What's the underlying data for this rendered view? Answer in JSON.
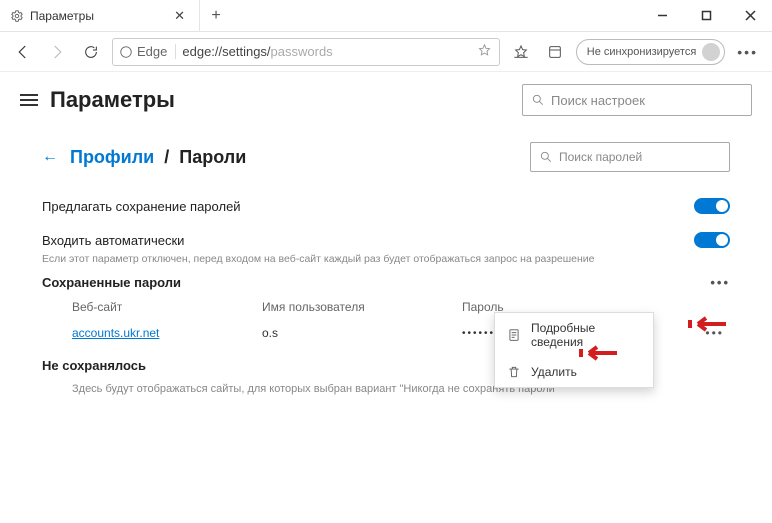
{
  "tab": {
    "title": "Параметры"
  },
  "addressbar": {
    "provider": "Edge",
    "url_prefix": "edge://settings/",
    "url_path": "passwords"
  },
  "sync_pill": "Не синхронизируется",
  "settings_title": "Параметры",
  "settings_search_placeholder": "Поиск настроек",
  "breadcrumb": {
    "parent": "Профили",
    "sep": "/",
    "current": "Пароли"
  },
  "passwords_search_placeholder": "Поиск паролей",
  "offer_save": {
    "label": "Предлагать сохранение паролей"
  },
  "auto_signin": {
    "label": "Входить автоматически",
    "sub": "Если этот параметр отключен, перед входом на веб-сайт каждый раз будет отображаться запрос на разрешение"
  },
  "saved_heading": "Сохраненные пароли",
  "columns": {
    "site": "Веб-сайт",
    "user": "Имя пользователя",
    "pass": "Пароль"
  },
  "row1": {
    "site": "accounts.ukr.net",
    "user": "o.s",
    "pass": "••••••••"
  },
  "never_saved": {
    "title": "Не сохранялось",
    "sub": "Здесь будут отображаться сайты, для которых выбран вариант \"Никогда не сохранять пароли\""
  },
  "ctx": {
    "details": "Подробные сведения",
    "delete": "Удалить"
  }
}
